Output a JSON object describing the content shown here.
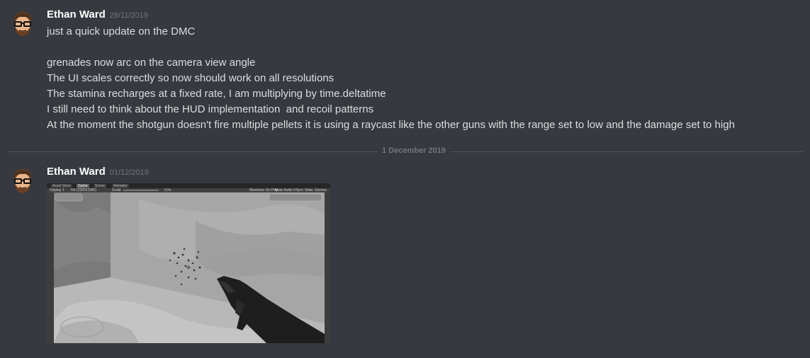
{
  "messages": [
    {
      "author": "Ethan Ward",
      "timestamp": "28/11/2019",
      "lines": [
        "just a quick update on the DMC",
        "",
        "grenades now arc on the camera view angle",
        "The UI scales correctly so now should work on all resolutions",
        "The stamina recharges at a fixed rate, I am multiplying by time.deltatime",
        "I still need to think about the HUD implementation  and recoil patterns",
        "At the moment the shotgun doesn't fire multiple pellets it is using a raycast like the other guns with the range set to low and the damage set to high"
      ]
    },
    {
      "author": "Ethan Ward",
      "timestamp": "01/12/2019"
    }
  ],
  "divider": {
    "label": "1 December 2019"
  },
  "attachment": {
    "tabs": [
      "Asset Store",
      "Game",
      "Scene",
      "Animator"
    ],
    "toolbar": {
      "display": "Display 1",
      "resolution": "Hd (1920x1080)",
      "scale_label": "Scale",
      "scale_value": "0.5x",
      "maximize": "Maximize On Play",
      "mute": "Mute Audio",
      "vsync": "VSync",
      "stats": "Stats",
      "gizmos": "Gizmos"
    }
  },
  "colors": {
    "background": "#36393f",
    "author": "#ffffff",
    "text": "#dcddde",
    "timestamp": "#72767d",
    "divider": "#4f545c"
  }
}
